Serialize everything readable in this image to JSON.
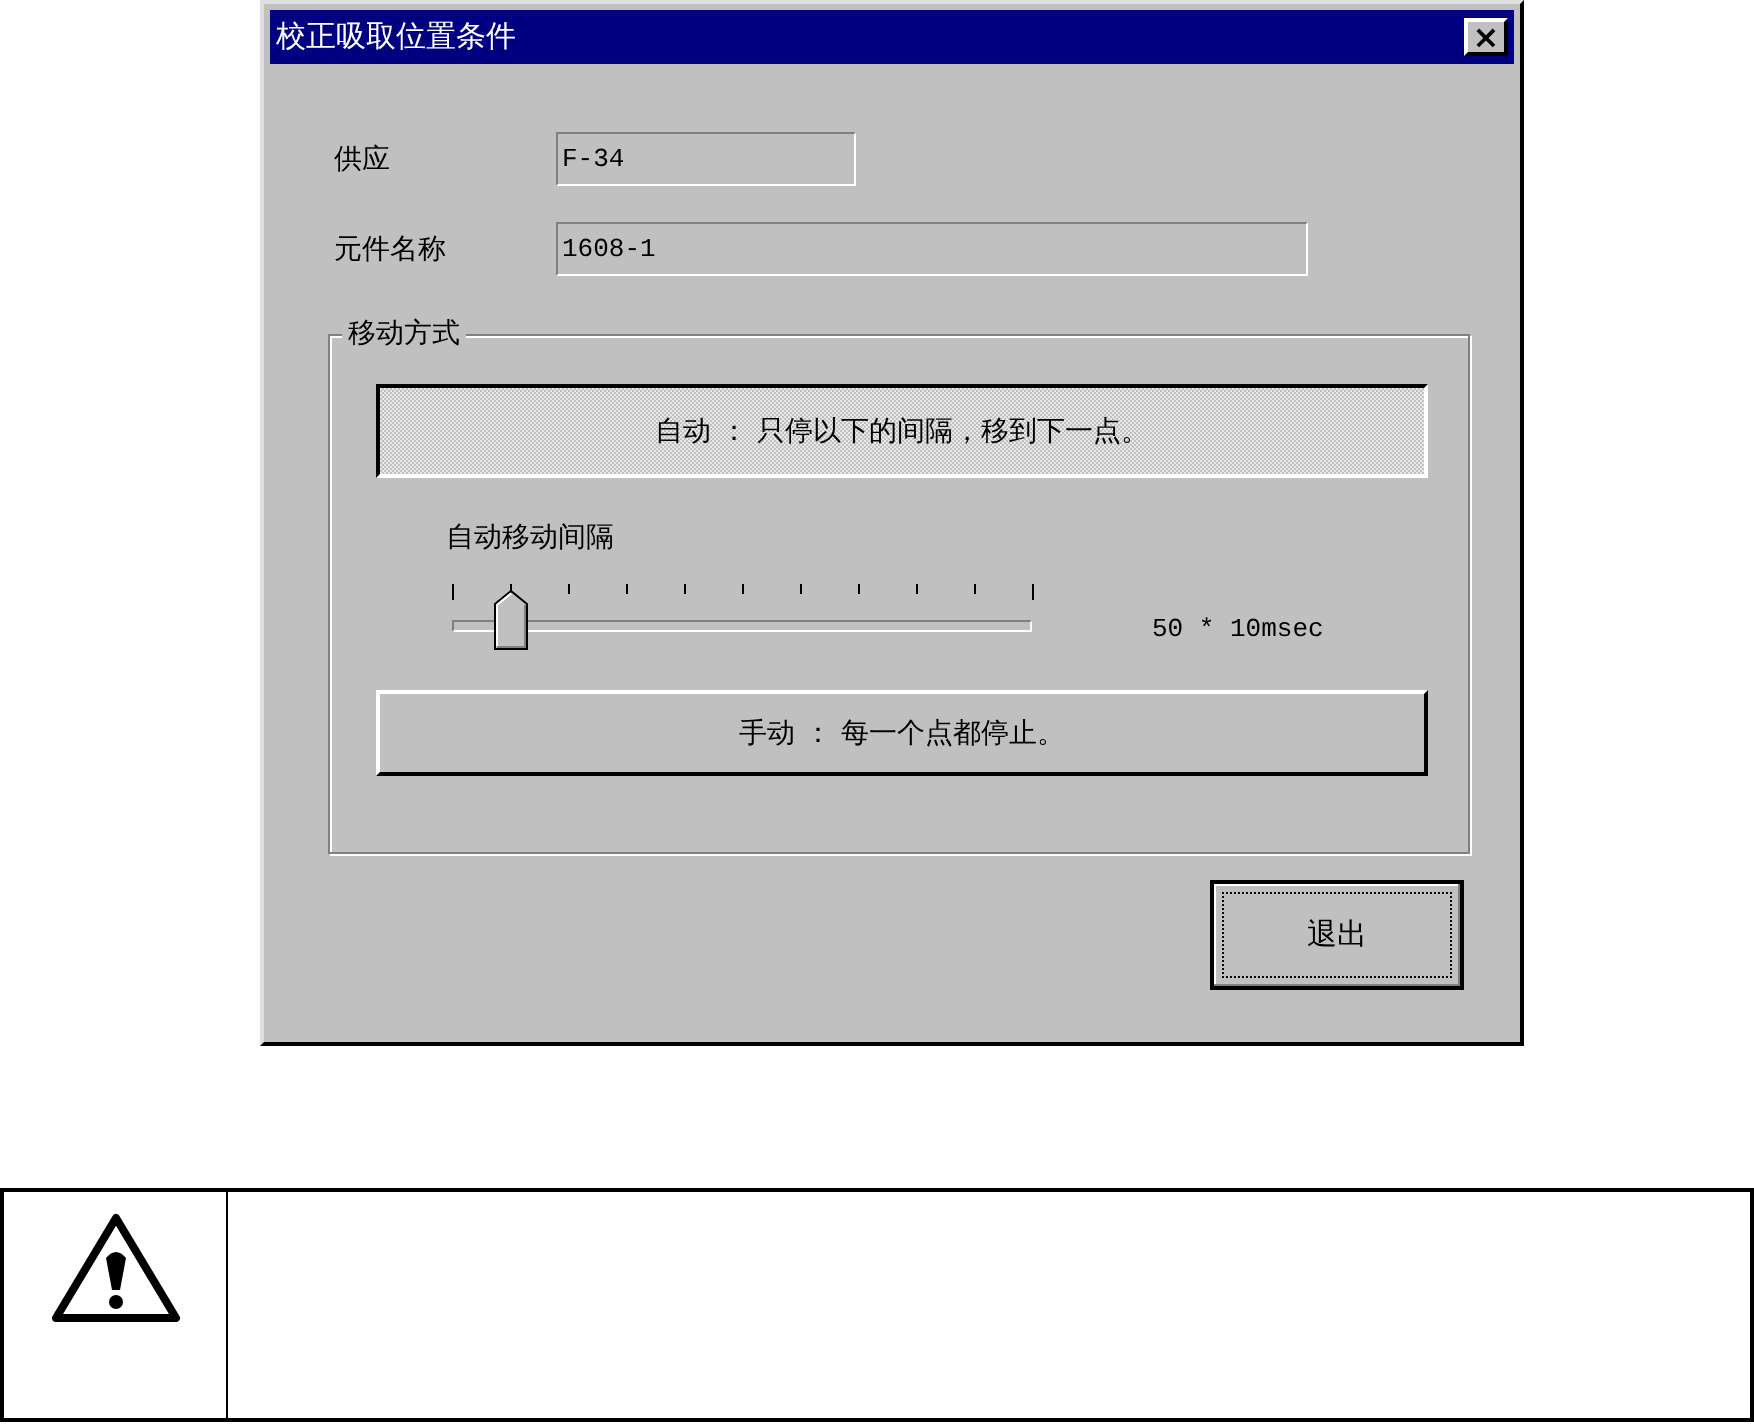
{
  "window": {
    "title": "校正吸取位置条件",
    "close": "×"
  },
  "fields": [
    {
      "label": "供应",
      "value": "F-34"
    },
    {
      "label": "元件名称",
      "value": "1608-1"
    }
  ],
  "group": {
    "title": "移动方式",
    "modes": [
      {
        "label": "自动 ： 只停以下的间隔，移到下一点。",
        "selected": true
      },
      {
        "label": "手动 ： 每一个点都停止。",
        "selected": false
      }
    ],
    "slider": {
      "label": "自动移动间隔",
      "reading": "50 * 10msec"
    }
  },
  "buttons": [
    {
      "label": "退出",
      "focused": true
    }
  ]
}
